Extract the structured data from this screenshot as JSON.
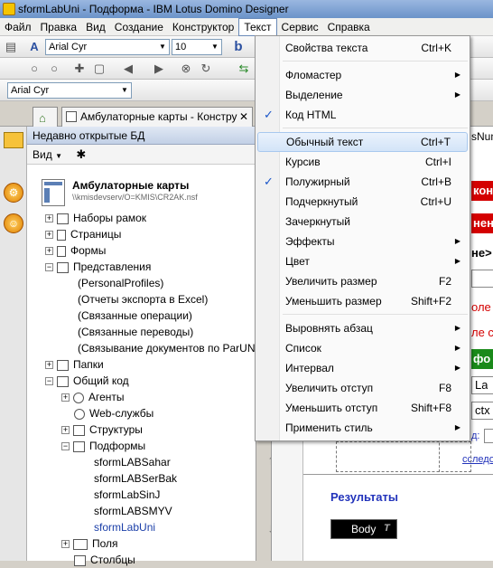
{
  "window": {
    "title": "sformLabUni - Подформа - IBM Lotus Domino Designer"
  },
  "menubar": {
    "items": [
      "Файл",
      "Правка",
      "Вид",
      "Создание",
      "Конструктор",
      "Текст",
      "Сервис",
      "Справка"
    ],
    "active": "Текст"
  },
  "toolbar": {
    "font_name": "Arial Cyr",
    "font_size": "10",
    "font_name_2": "Arial Cyr",
    "bold_label": "b"
  },
  "tabs": [
    {
      "label": "Амбулаторные карты - Констру"
    }
  ],
  "nav": {
    "header": "Недавно открытые БД",
    "view_label": "Вид",
    "db_title": "Амбулаторные карты",
    "db_path": "\\\\kmisdevserv/O=KMIS\\CR2AK.nsf",
    "tree": [
      "Наборы рамок",
      "Страницы",
      "Формы",
      "Представления",
      "(PersonalProfiles)",
      "(Отчеты экспорта в Excel)",
      "(Связанные операции)",
      "(Связанные переводы)",
      "(Связывание документов по ParUNID)",
      "Папки",
      "Общий код",
      "Агенты",
      "Web-службы",
      "Структуры",
      "Подформы",
      "sformLABSahar",
      "sformLABSerBak",
      "sformLabSinJ",
      "sformLABSMYV",
      "sformLabUni",
      "Поля",
      "Столбцы"
    ]
  },
  "canvas": {
    "frag_top": "sNum",
    "frag_kon": "кон",
    "frag_nen": "нен",
    "frag_ne": "не>",
    "frag_ole": "оле",
    "frag_les": "ле с",
    "frag_f": "фо",
    "frag_la": "La",
    "frag_ctx": "ctx",
    "frag_d": "д:",
    "frag_issled": "сследо",
    "results_label": "Результаты",
    "body_label": "Body"
  },
  "text_menu": {
    "items": [
      {
        "label": "Свойства текста",
        "shortcut": "Ctrl+K",
        "submenu": false,
        "checked": false
      },
      {
        "label": "Фломастер",
        "shortcut": "",
        "submenu": true,
        "checked": false
      },
      {
        "label": "Выделение",
        "shortcut": "",
        "submenu": true,
        "checked": false
      },
      {
        "label": "Код HTML",
        "shortcut": "",
        "submenu": false,
        "checked": true
      },
      {
        "label": "Обычный текст",
        "shortcut": "Ctrl+T",
        "submenu": false,
        "checked": false
      },
      {
        "label": "Курсив",
        "shortcut": "Ctrl+I",
        "submenu": false,
        "checked": false
      },
      {
        "label": "Полужирный",
        "shortcut": "Ctrl+B",
        "submenu": false,
        "checked": true
      },
      {
        "label": "Подчеркнутый",
        "shortcut": "Ctrl+U",
        "submenu": false,
        "checked": false
      },
      {
        "label": "Зачеркнутый",
        "shortcut": "",
        "submenu": false,
        "checked": false
      },
      {
        "label": "Эффекты",
        "shortcut": "",
        "submenu": true,
        "checked": false
      },
      {
        "label": "Цвет",
        "shortcut": "",
        "submenu": true,
        "checked": false
      },
      {
        "label": "Увеличить размер",
        "shortcut": "F2",
        "submenu": false,
        "checked": false
      },
      {
        "label": "Уменьшить размер",
        "shortcut": "Shift+F2",
        "submenu": false,
        "checked": false
      },
      {
        "label": "Выровнять абзац",
        "shortcut": "",
        "submenu": true,
        "checked": false
      },
      {
        "label": "Список",
        "shortcut": "",
        "submenu": true,
        "checked": false
      },
      {
        "label": "Интервал",
        "shortcut": "",
        "submenu": true,
        "checked": false
      },
      {
        "label": "Увеличить отступ",
        "shortcut": "F8",
        "submenu": false,
        "checked": false
      },
      {
        "label": "Уменьшить отступ",
        "shortcut": "Shift+F8",
        "submenu": false,
        "checked": false
      },
      {
        "label": "Применить стиль",
        "shortcut": "",
        "submenu": true,
        "checked": false
      }
    ],
    "highlighted": "Обычный текст"
  },
  "glyphs": {
    "check": "✓",
    "submenu_arrow": "▶",
    "dropdown_arrow": "▼",
    "scroll_up": "⇧",
    "scroll_down": "⇩"
  },
  "colors": {
    "menu_highlight": "#d3e4f8",
    "check_blue": "#1b56c9",
    "link_blue": "#1a3ea8",
    "canvas_red": "#d40000",
    "canvas_green": "#1a8a1a",
    "results_blue": "#2233bb"
  }
}
